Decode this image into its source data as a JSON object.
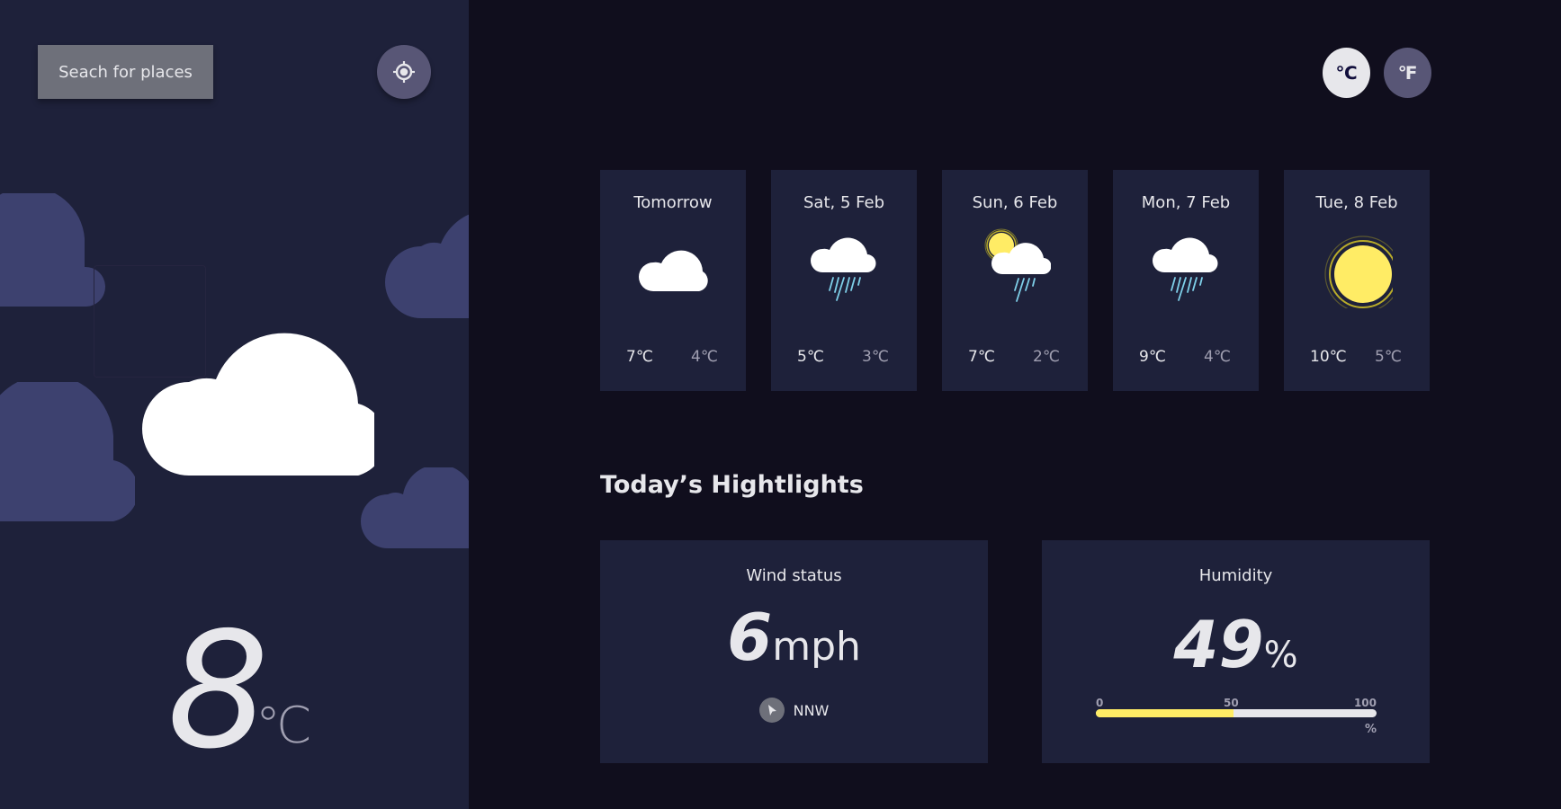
{
  "sidebar": {
    "search_label": "Seach for places",
    "location_icon": "crosshair-gps-icon",
    "current_icon": "cloud-icon",
    "current_temp": "8",
    "current_unit": "℃"
  },
  "units": {
    "celsius": "℃",
    "fahrenheit": "℉",
    "active": "celsius"
  },
  "forecast": [
    {
      "date": "Tomorrow",
      "icon": "cloud-icon",
      "max": "7℃",
      "min": "4℃"
    },
    {
      "date": "Sat, 5 Feb",
      "icon": "rain-icon",
      "max": "5℃",
      "min": "3℃"
    },
    {
      "date": "Sun, 6 Feb",
      "icon": "sun-cloud-rain-icon",
      "max": "7℃",
      "min": "2℃"
    },
    {
      "date": "Mon, 7 Feb",
      "icon": "rain-icon",
      "max": "9℃",
      "min": "4℃"
    },
    {
      "date": "Tue, 8 Feb",
      "icon": "sun-icon",
      "max": "10℃",
      "min": "5℃"
    }
  ],
  "highlights": {
    "title": "Today’s Hightlights",
    "wind": {
      "label": "Wind status",
      "value": "6",
      "unit": "mph",
      "direction": "NNW",
      "direction_icon": "navigation-arrow-icon"
    },
    "humidity": {
      "label": "Humidity",
      "value": "49",
      "unit": "%",
      "percent": 49,
      "scale": [
        "0",
        "50",
        "100"
      ],
      "scale_unit": "%"
    }
  },
  "colors": {
    "sidebar_bg": "#1e213a",
    "page_bg": "#100e1d",
    "card_bg": "#1e213a",
    "accent_yellow": "#ffec65",
    "rain_blue": "#7ecfe8",
    "bg_cloud": "#3d416f"
  }
}
